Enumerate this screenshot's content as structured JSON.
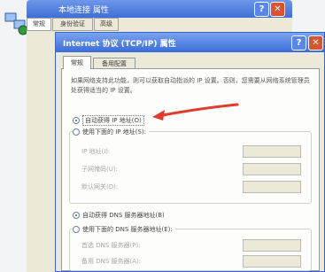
{
  "background_window": {
    "title": "本地连接 属性",
    "tabs": [
      "常规",
      "身份验证",
      "高级"
    ],
    "help_label": "?",
    "close_label": "✕"
  },
  "dialog": {
    "title": "Internet 协议 (TCP/IP) 属性",
    "help_label": "?",
    "close_label": "✕",
    "tabs": [
      "常规",
      "备用配置"
    ],
    "description": "如果网络支持此功能，则可以获取自动指派的 IP 设置。否则，您需要从网络系统管理员处获得适当的 IP 设置。",
    "ip_options": {
      "auto": {
        "label": "自动获得 IP 地址(O)",
        "selected": true
      },
      "manual": {
        "label": "使用下面的 IP 地址(S):",
        "selected": false
      }
    },
    "ip_fields": [
      {
        "label": "IP 地址(I):",
        "value": ""
      },
      {
        "label": "子网掩码(U):",
        "value": ""
      },
      {
        "label": "默认网关(D):",
        "value": ""
      }
    ],
    "dns_options": {
      "auto": {
        "label": "自动获得 DNS 服务器地址(B)",
        "selected": true
      },
      "manual": {
        "label": "使用下面的 DNS 服务器地址(E):",
        "selected": false
      }
    },
    "dns_fields": [
      {
        "label": "首选 DNS 服务器(P):",
        "value": ""
      },
      {
        "label": "备用 DNS 服务器(A):",
        "value": ""
      }
    ]
  },
  "colors": {
    "titlebar": "#3a6cd9",
    "close_button": "#d9532f",
    "annotation_arrow": "#e03c2c"
  },
  "icons": [
    "network-connection-icon",
    "red-annotation-arrow"
  ]
}
